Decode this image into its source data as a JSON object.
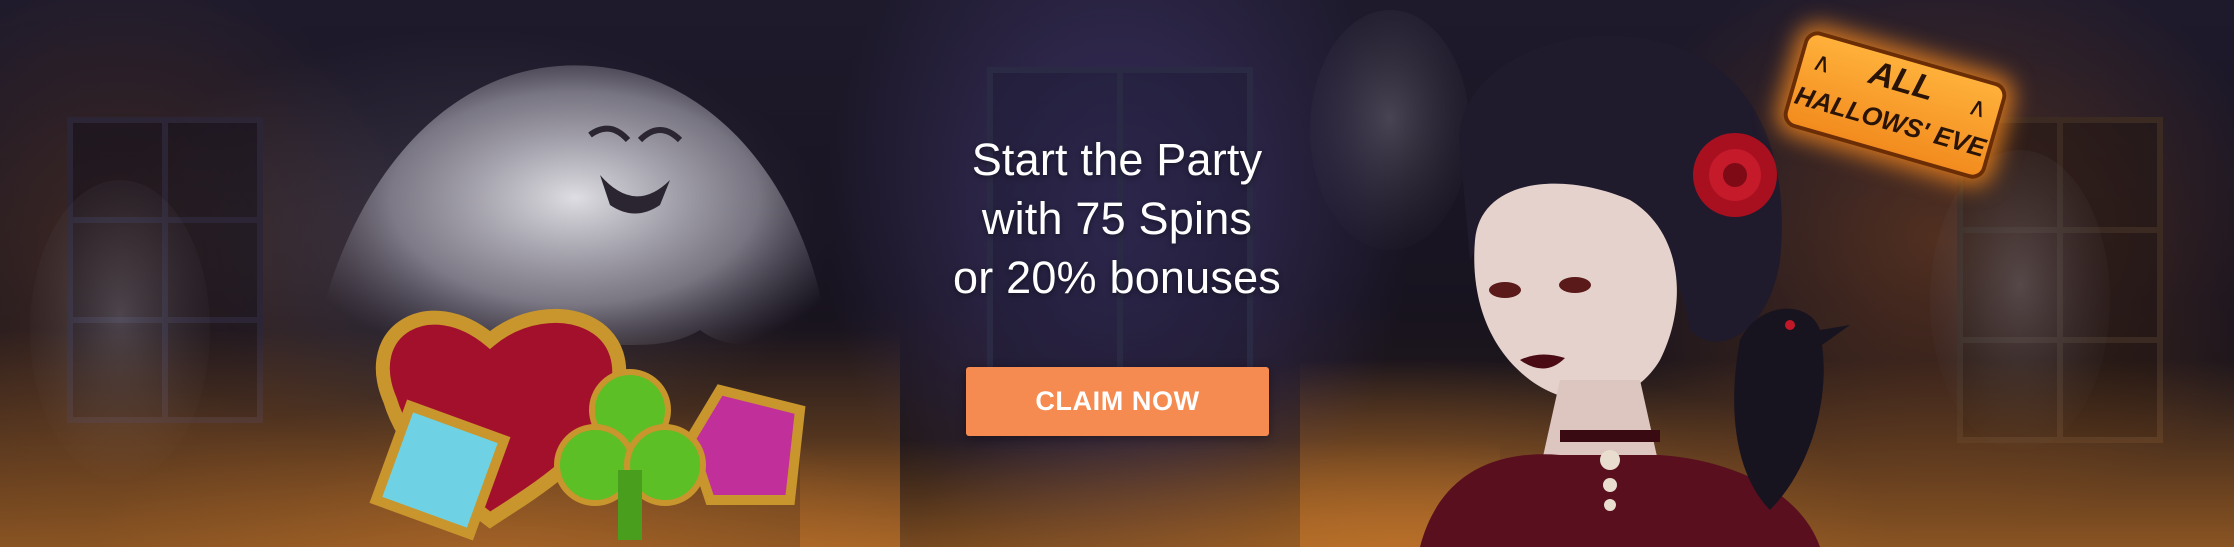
{
  "banner": {
    "headline_lines": [
      "Start the Party",
      "with 75 Spins",
      "or 20% bonuses"
    ],
    "cta_label": "CLAIM NOW",
    "badge": {
      "line1": "ALL",
      "line2": "HALLOWS' EVE"
    }
  },
  "colors": {
    "cta_background": "#f58b51",
    "headline_text": "#ffffff",
    "badge_orange": "#f28a1e"
  },
  "icons": {
    "ghost": "ghost-icon",
    "gems": "heart-club-gem-symbols",
    "vampire": "vampire-woman-illustration",
    "raven": "raven-icon",
    "bat": "bat-icon"
  }
}
